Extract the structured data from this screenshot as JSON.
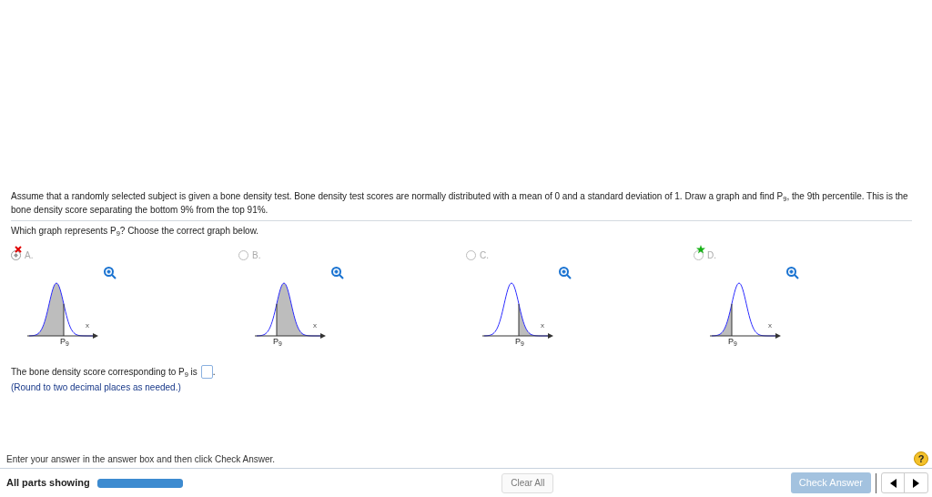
{
  "question": {
    "text": "Assume that a randomly selected subject is given a bone density test. Bone density test scores are normally distributed with a mean of 0 and a standard deviation of 1. Draw a graph and find P$_{9}$, the 9th percentile. This is the bone density score separating the bottom 9% from the top 91%.",
    "prompt": "Which graph represents P$_{9}$? Choose the correct graph below.",
    "options": [
      {
        "letter": "A.",
        "selected": true,
        "wrong": true,
        "correct": false,
        "kind": "leftbody",
        "axis_label": "x",
        "point_label": "P$_{9}$"
      },
      {
        "letter": "B.",
        "selected": false,
        "wrong": false,
        "correct": false,
        "kind": "rightbody",
        "axis_label": "x",
        "point_label": "P$_{9}$"
      },
      {
        "letter": "C.",
        "selected": false,
        "wrong": false,
        "correct": false,
        "kind": "righttail",
        "axis_label": "x",
        "point_label": "P$_{9}$"
      },
      {
        "letter": "D.",
        "selected": false,
        "wrong": false,
        "correct": true,
        "kind": "lefttail",
        "axis_label": "x",
        "point_label": "P$_{9}$"
      }
    ],
    "answer_sentence": "The bone density score corresponding to P$_{9}$ is",
    "answer_end": ".",
    "hint": "(Round to two decimal places as needed.)"
  },
  "help": "?",
  "instruction": "Enter your answer in the answer box and then click Check Answer.",
  "footer": {
    "label": "All parts showing",
    "progress": {
      "level": 1
    },
    "clear_button": "Clear All",
    "check_button": {
      "label": "Check Answer",
      "disabled": true
    }
  }
}
